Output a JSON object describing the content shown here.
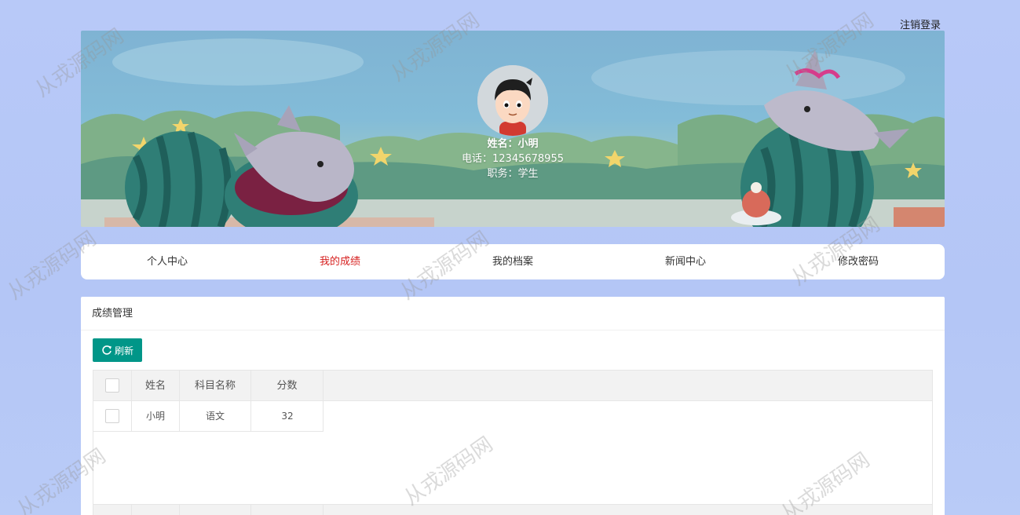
{
  "header": {
    "logout_label": "注销登录"
  },
  "profile": {
    "name_line": "姓名：小明",
    "phone_line": "电话：12345678955",
    "role_line": "职务：学生"
  },
  "nav": {
    "items": [
      {
        "label": "个人中心",
        "active": false
      },
      {
        "label": "我的成绩",
        "active": true
      },
      {
        "label": "我的档案",
        "active": false
      },
      {
        "label": "新闻中心",
        "active": false
      },
      {
        "label": "修改密码",
        "active": false
      }
    ]
  },
  "panel": {
    "title": "成绩管理",
    "refresh_label": "刷新",
    "table": {
      "headers": [
        "姓名",
        "科目名称",
        "分数"
      ],
      "rows": [
        [
          "小明",
          "语文",
          "32"
        ]
      ]
    }
  },
  "watermark": "从戎源码网",
  "colors": {
    "accent": "#009688",
    "active_nav": "#d6201f",
    "page_bg": "#b8c9f8"
  }
}
